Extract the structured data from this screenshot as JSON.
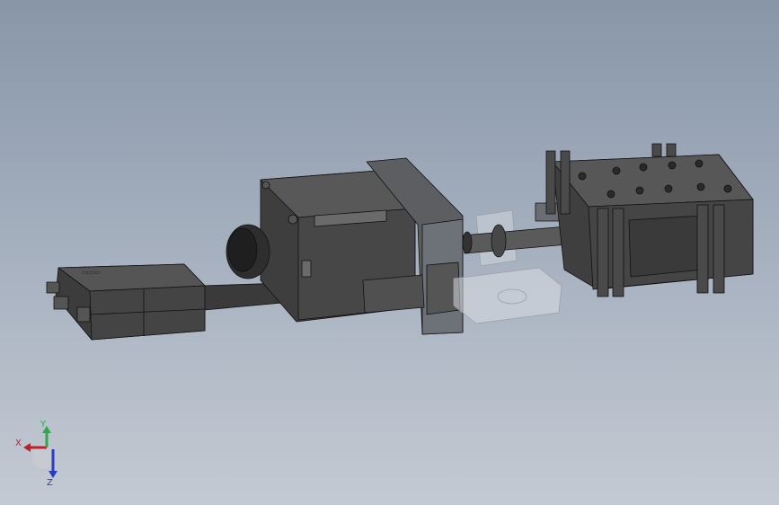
{
  "triad": {
    "x_label": "X",
    "y_label": "Y",
    "z_label": "Z",
    "x_color": "#c0202a",
    "y_color": "#2fa84a",
    "z_color": "#2a3cc0"
  },
  "model": {
    "body_color": "#4a4a4a",
    "edge_color": "#111111",
    "transparent_part_color": "#d9dde3"
  }
}
